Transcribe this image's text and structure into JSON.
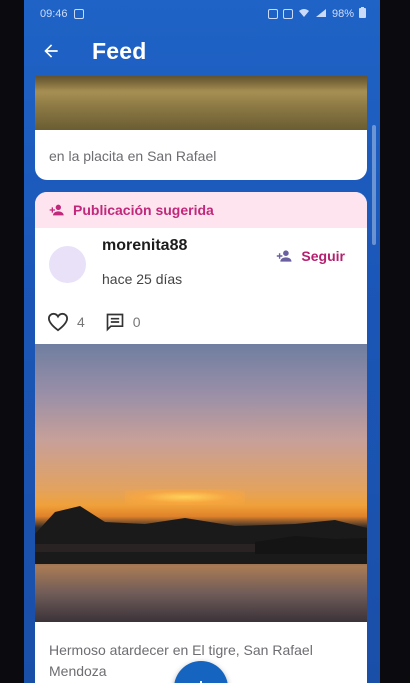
{
  "status_bar": {
    "time": "09:46",
    "battery": "98%"
  },
  "app_bar": {
    "title": "Feed",
    "back_icon": "arrow-left-icon"
  },
  "posts": [
    {
      "caption": "en la placita en San Rafael"
    },
    {
      "banner": "Publicación sugerida",
      "username": "morenita88",
      "time_ago": "hace 25 días",
      "follow_label": "Seguir",
      "likes": "4",
      "comments": "0",
      "caption_line1": "Hermoso atardecer en El tigre, San Rafael",
      "caption_line2": "Mendoza"
    }
  ],
  "colors": {
    "primary": "#1f63c6",
    "accent_pink": "#c1277a",
    "banner_bg": "#fde4ef"
  }
}
